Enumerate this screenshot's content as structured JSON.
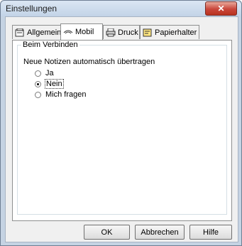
{
  "window": {
    "title": "Einstellungen",
    "close_glyph": "✕"
  },
  "tabs": [
    {
      "label": "Allgemein",
      "icon": "general-settings-icon",
      "active": false
    },
    {
      "label": "Mobil",
      "icon": "mobile-connection-icon",
      "active": true
    },
    {
      "label": "Druck",
      "icon": "printer-icon",
      "active": false
    },
    {
      "label": "Papierhalter",
      "icon": "paper-holder-icon",
      "active": false
    }
  ],
  "group": {
    "legend": "Beim Verbinden",
    "question": "Neue Notizen automatisch übertragen",
    "options": [
      {
        "label": "Ja",
        "selected": false
      },
      {
        "label": "Nein",
        "selected": true
      },
      {
        "label": "Mich fragen",
        "selected": false
      }
    ]
  },
  "buttons": {
    "ok": "OK",
    "cancel": "Abbrechen",
    "help": "Hilfe"
  },
  "colors": {
    "accent_close": "#c9463a",
    "frame": "#c5d3e3"
  }
}
